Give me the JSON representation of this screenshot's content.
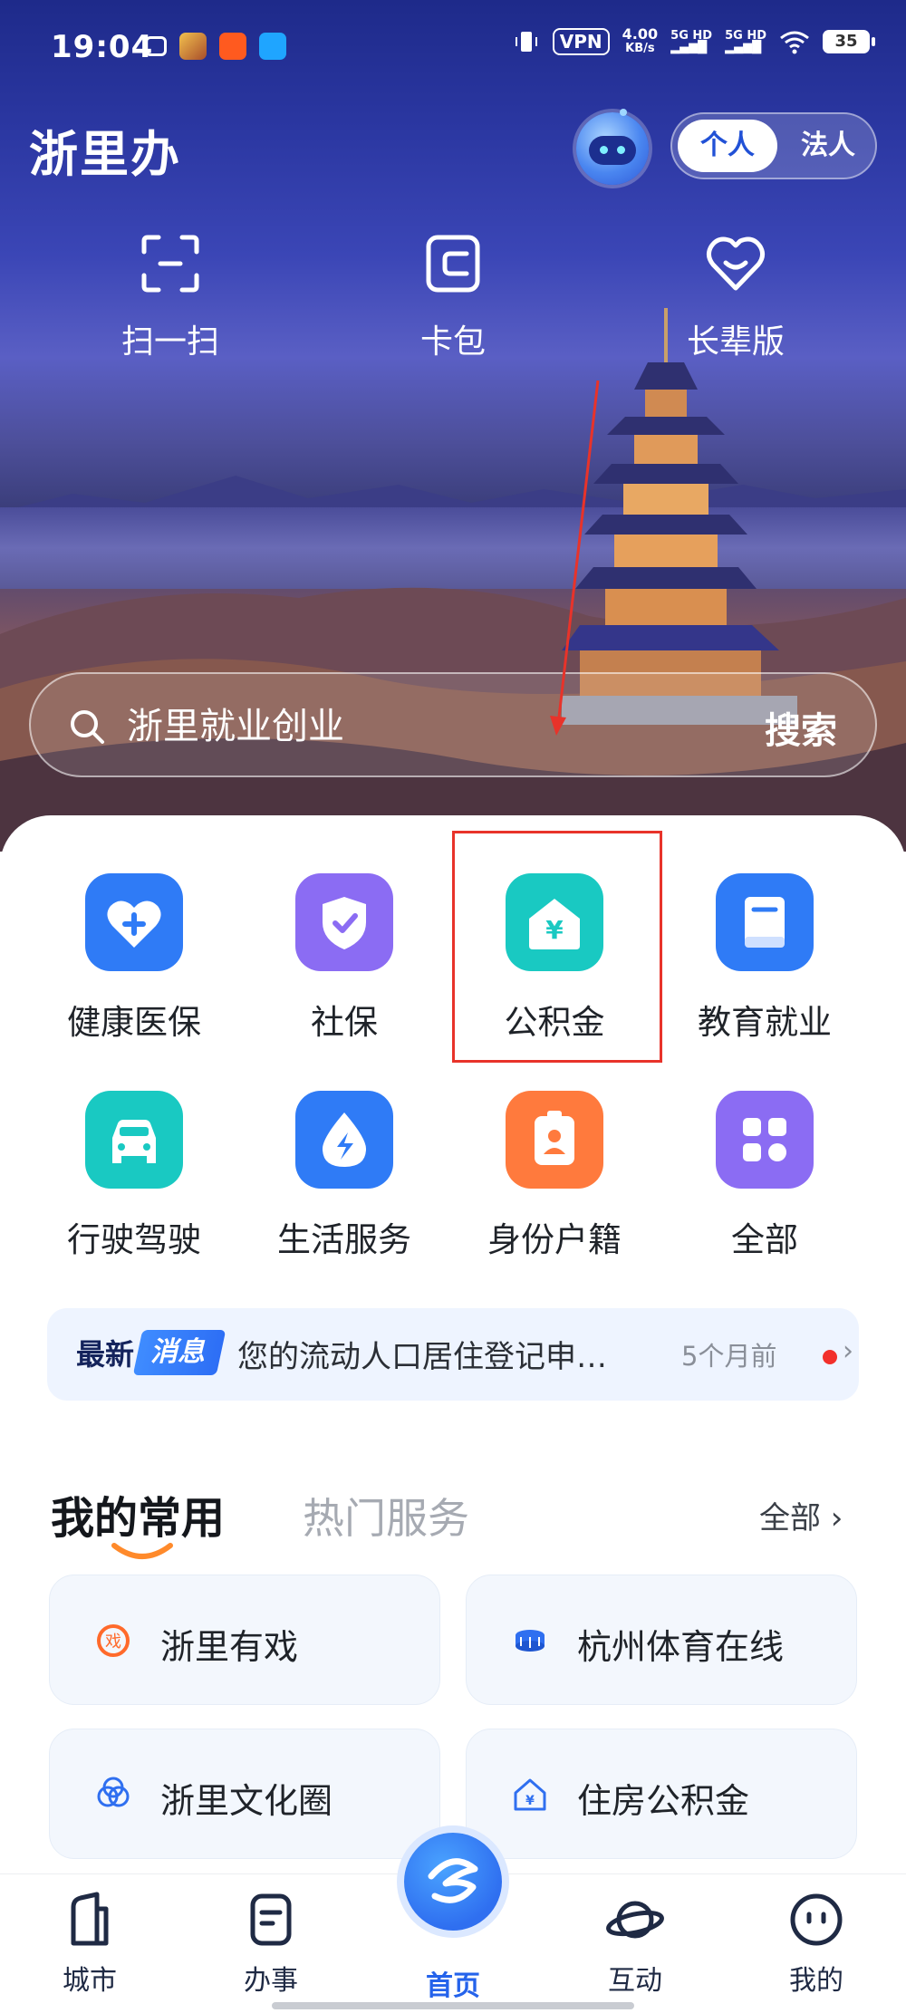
{
  "status_bar": {
    "time": "19:04",
    "vpn": "VPN",
    "speed_value": "4.00",
    "speed_unit": "KB/s",
    "net1": "5G HD",
    "net2": "5G HD",
    "battery": "35"
  },
  "header": {
    "brand": "浙里办",
    "role_active": "个人",
    "role_inactive": "法人"
  },
  "quick_actions": [
    {
      "label": "扫一扫",
      "icon": "scan-icon"
    },
    {
      "label": "卡包",
      "icon": "wallet-icon"
    },
    {
      "label": "长辈版",
      "icon": "heart-icon"
    }
  ],
  "search": {
    "placeholder": "浙里就业创业",
    "button": "搜索"
  },
  "services": [
    {
      "label": "健康医保",
      "icon": "health-insurance-icon",
      "color": "#2f7bf6"
    },
    {
      "label": "社保",
      "icon": "social-security-icon",
      "color": "#8b6cf3"
    },
    {
      "label": "公积金",
      "icon": "housing-fund-icon",
      "color": "#19c9c2"
    },
    {
      "label": "教育就业",
      "icon": "education-icon",
      "color": "#2f7bf6"
    },
    {
      "label": "行驶驾驶",
      "icon": "car-icon",
      "color": "#19c9c2"
    },
    {
      "label": "生活服务",
      "icon": "water-drop-icon",
      "color": "#2f7bf6"
    },
    {
      "label": "身份户籍",
      "icon": "id-card-icon",
      "color": "#ff7a3d"
    },
    {
      "label": "全部",
      "icon": "all-apps-icon",
      "color": "#8b6cf3"
    }
  ],
  "news": {
    "tag_prefix": "最新",
    "tag_suffix": "消息",
    "text": "您的流动人口居住登记申…",
    "time": "5个月前"
  },
  "favorites_tabs": {
    "active": "我的常用",
    "inactive": "热门服务",
    "all": "全部"
  },
  "favorites": [
    {
      "label": "浙里有戏",
      "icon": "drama-icon"
    },
    {
      "label": "杭州体育在线",
      "icon": "stadium-icon"
    },
    {
      "label": "浙里文化圈",
      "icon": "culture-circle-icon"
    },
    {
      "label": "住房公积金",
      "icon": "house-fund-icon"
    }
  ],
  "bottom_nav": [
    {
      "label": "城市",
      "icon": "city-icon"
    },
    {
      "label": "办事",
      "icon": "tasks-icon"
    },
    {
      "label": "首页",
      "icon": "home-logo-icon"
    },
    {
      "label": "互动",
      "icon": "planet-icon"
    },
    {
      "label": "我的",
      "icon": "profile-icon"
    }
  ],
  "colors": {
    "accent": "#2563eb",
    "highlight_box": "#e8332a"
  }
}
